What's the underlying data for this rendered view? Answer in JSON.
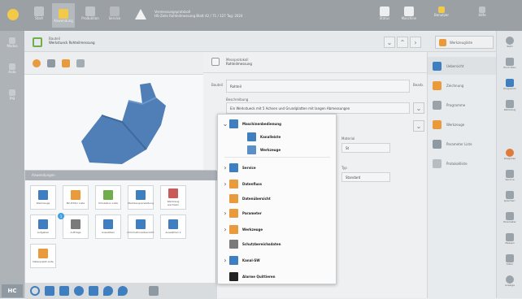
{
  "app": {
    "colors": {
      "accent": "#3f7fbf",
      "orange": "#e89a3c",
      "green": "#6fae4a",
      "yellow": "#f3c94a",
      "topbar": "#9ba0a5"
    }
  },
  "header": {
    "title": "Vermessungsprotokoll",
    "subtitle": "HS-Zeile Rohteilmessung Blatt 42 / 71 / 127 Tag: 2024",
    "tabs": [
      {
        "label": "Start",
        "icon": "home-icon"
      },
      {
        "label": "Anwendung",
        "icon": "app-icon"
      },
      {
        "label": "Produktion",
        "icon": "production-icon"
      },
      {
        "label": "Service",
        "icon": "service-icon"
      }
    ],
    "right": [
      {
        "label": "Status",
        "icon": "status-icon"
      },
      {
        "label": "Maschine",
        "icon": "machine-icon"
      },
      {
        "label": "Benutzer",
        "icon": "user-icon"
      },
      {
        "label": "Hilfe",
        "icon": "help-icon"
      }
    ]
  },
  "toolbar": {
    "breadcrumb_top": "Bauteil",
    "breadcrumb_main": "Werkstueck Rohteilmessung",
    "save_label": "Werkzeugliste"
  },
  "form": {
    "section_title": "Messprotokoll",
    "section_sub": "Rohteilmessung",
    "field1_label": "Bauteil",
    "field1_value": "Rohteil",
    "field2_label": "Beschreibung",
    "field2_value": "Ein Werkstueck mit 5 Achsen und Grundplatten mit langen Abmessungen",
    "edit_label": "Bearb.",
    "field3_label": "Material",
    "field3_value": "St",
    "field4_label": "Typ",
    "field4_value": "Standard"
  },
  "side_menu": {
    "items": [
      "Uebersicht",
      "Zeichnung",
      "Programme",
      "Werkzeuge",
      "Parameter Liste",
      "Protokollliste"
    ]
  },
  "apps_panel": {
    "title": "Anwendungen",
    "badge": "1",
    "tiles": [
      {
        "label": "Werkzeuge",
        "color": "#3f7fbf"
      },
      {
        "label": "NC-Editor Liste",
        "color": "#e89a3c"
      },
      {
        "label": "Simulation Liste",
        "color": "#6fae4a"
      },
      {
        "label": "Werkzeugverwaltung",
        "color": "#3f7fbf"
      },
      {
        "label": "Werkzeug wechseln",
        "color": "#c85a5a"
      },
      {
        "label": "Aufgaben",
        "color": "#3f7fbf"
      },
      {
        "label": "Aufträge",
        "color": "#7a7a7a"
      },
      {
        "label": "Auswählen",
        "color": "#3f7fbf"
      },
      {
        "label": "Informationsübersicht",
        "color": "#3f7fbf"
      },
      {
        "label": "Auswählen 2",
        "color": "#3f7fbf"
      },
      {
        "label": "Datenpaket Liste",
        "color": "#e89a3c"
      }
    ]
  },
  "context_menu": {
    "items": [
      {
        "label": "Maschinenbedienung",
        "expand": "⌄",
        "color": "#3f7fbf"
      },
      {
        "label": "Kanalleiste",
        "expand": "",
        "color": "#3f7fbf"
      },
      {
        "label": "Werkzeuge",
        "expand": "",
        "color": "#5a8fc8"
      },
      {
        "label": "Service",
        "expand": "›",
        "color": "#3f7fbf"
      },
      {
        "label": "Datenfluss",
        "expand": "›",
        "color": "#e89a3c"
      },
      {
        "label": "Datenübersicht",
        "expand": "",
        "color": "#e89a3c"
      },
      {
        "label": "Parameter",
        "expand": "›",
        "color": "#e89a3c"
      },
      {
        "label": "Werkzeuge",
        "expand": "›",
        "color": "#e89a3c"
      },
      {
        "label": "Schutzbereichsdaten",
        "expand": "",
        "color": "#7a7a7a"
      },
      {
        "label": "Kanal-SW",
        "expand": "›",
        "color": "#3f7fbf"
      },
      {
        "label": "Alarme Quittieren",
        "expand": "",
        "color": "#222222"
      }
    ]
  },
  "bottom_dock": {
    "items": [
      "search-icon",
      "folder-icon",
      "chart-icon",
      "user-icon",
      "document-icon",
      "location-icon",
      "location-icon"
    ]
  },
  "right_rail": {
    "items": [
      "Start",
      "Einrichten",
      "Programm",
      "Werkzeug",
      "Diagnose",
      "Service",
      "Speichern",
      "Parameter",
      "Messen",
      "Editor",
      "Anzeige"
    ]
  },
  "left_rail": {
    "items": [
      "Modus",
      "Auto",
      "Jog"
    ]
  }
}
